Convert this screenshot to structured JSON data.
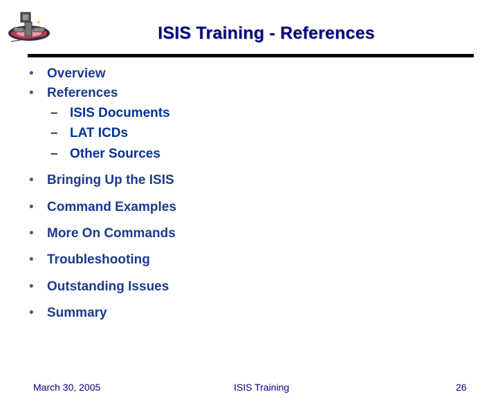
{
  "slide": {
    "title": "ISIS Training - References",
    "bullets": [
      "Overview",
      "References",
      "Bringing Up the ISIS",
      "Command Examples",
      "More On Commands",
      "Troubleshooting",
      "Outstanding Issues",
      "Summary"
    ],
    "sub_bullets": [
      "ISIS Documents",
      "LAT ICDs",
      "Other Sources"
    ],
    "bullet_glyph": "•",
    "sub_bullet_glyph": "–"
  },
  "footer": {
    "date": "March 30, 2005",
    "center": "ISIS Training",
    "page_number": "26"
  },
  "colors": {
    "title": "#000080",
    "bullet_text": "#1a3a8c",
    "rule": "#000000"
  },
  "icons": {
    "logo": "glast-mission-logo"
  }
}
